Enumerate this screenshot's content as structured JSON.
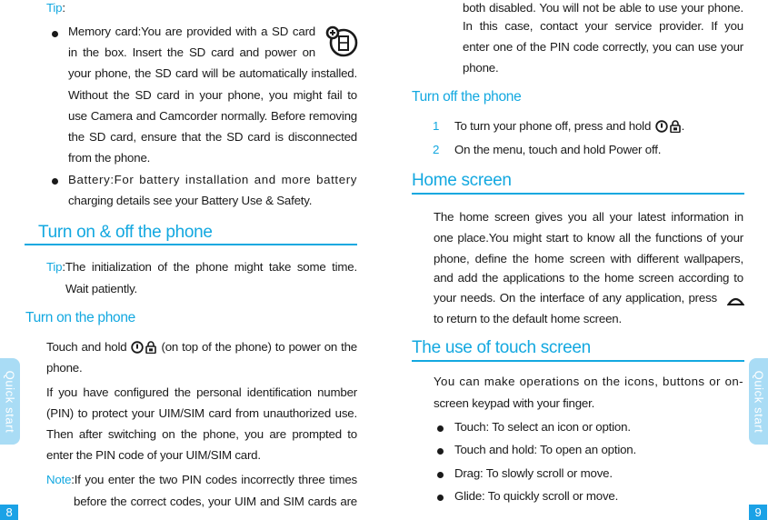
{
  "side_tab": {
    "label": "Quick start"
  },
  "left_page": {
    "page_number": "8",
    "tip_label": "Tip",
    "tip_colon": ":",
    "bullets": [
      {
        "lines": [
          "Memory card:You are provided with a SD card",
          "in the box. Insert the SD card and power on",
          "your phone, the SD card will be automatically installed.",
          "Without the SD card in your phone, you might fail to",
          "use Camera and Camcorder normally. Before removing",
          "the SD card, ensure that the SD card is disconnected",
          "from the phone."
        ],
        "icon": "sd-card-icon"
      },
      {
        "lines": [
          "Battery:For battery installation and more battery",
          "charging details see your Battery Use & Safety."
        ]
      }
    ],
    "section_heading": "Turn on & off the phone",
    "init_tip": {
      "label": "Tip",
      "line1": ":The initialization of the phone might take some time.",
      "line2": "Wait patiently."
    },
    "turn_on": {
      "heading": "Turn on the phone",
      "touch_pre": "Touch and hold",
      "touch_post": "(on top of the phone) to power on the",
      "touch_line2": "phone.",
      "icons": [
        "power-icon",
        "lock-icon"
      ],
      "pin_lines": [
        "If you have configured the personal identification number",
        "(PIN) to protect your UIM/SIM card from unauthorized use.",
        "Then after switching on the phone, you are prompted to",
        "enter the PIN code of your UIM/SIM card."
      ],
      "note_label": "Note",
      "note_line1": ":If you enter the two PIN codes incorrectly three times",
      "note_line2": "before the correct codes, your UIM and SIM cards are"
    }
  },
  "right_page": {
    "page_number": "9",
    "note_continued": [
      "both disabled. You will not be able to use your phone.",
      "In this case, contact your service provider. If you",
      "enter one of the PIN code correctly, you can use your",
      "phone."
    ],
    "turn_off": {
      "heading": "Turn off the phone",
      "steps": [
        {
          "num": "1",
          "text": "To turn your phone off, press and hold",
          "suffix": "."
        },
        {
          "num": "2",
          "text": "On the menu, touch and hold Power off."
        }
      ]
    },
    "home_screen": {
      "heading": "Home screen",
      "lines": [
        "The home screen gives you all your latest information in",
        "one place.You might start to know all the functions of your",
        "phone, define the home screen with different wallpapers,",
        "and add the applications to the home screen according to",
        "your needs. On the interface of any application, press",
        "to return to the default home screen."
      ],
      "icon": "home-key-icon"
    },
    "touch_screen": {
      "heading": "The use of touch screen",
      "intro_lines": [
        "You can make operations on the icons, buttons or on-",
        "screen keypad with your finger."
      ],
      "bullets": [
        "Touch: To select an icon or option.",
        "Touch and hold: To open an option.",
        "Drag: To slowly scroll or move.",
        "Glide: To quickly scroll or move."
      ]
    }
  },
  "colors": {
    "accent": "#13a8e0",
    "page_number_bg": "#1ba2e6",
    "side_tab_bg": "#a9dcf5",
    "body_text": "#1a1a1a"
  }
}
